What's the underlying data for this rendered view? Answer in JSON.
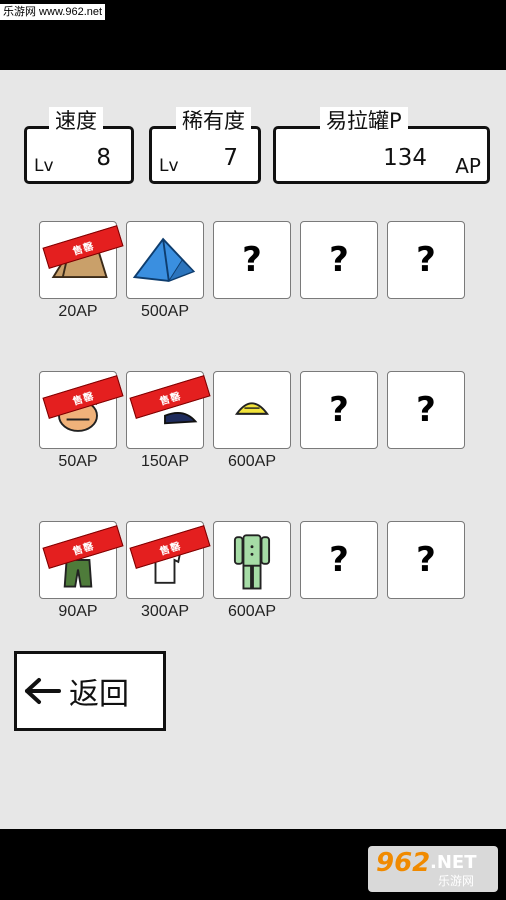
{
  "watermark_top": "乐游网 www.962.net",
  "stats": {
    "speed": {
      "title": "速度",
      "lv_label": "Lv",
      "value": "8"
    },
    "rarity": {
      "title": "稀有度",
      "lv_label": "Lv",
      "value": "7"
    },
    "cans": {
      "title": "易拉罐P",
      "value": "134",
      "unit": "AP"
    }
  },
  "sold_label": "售罄",
  "rows": [
    {
      "items": [
        {
          "kind": "mat-icon",
          "sold": true,
          "price": "20AP"
        },
        {
          "kind": "tent-icon",
          "sold": false,
          "price": "500AP"
        },
        {
          "kind": "question-icon",
          "sold": false,
          "price": "",
          "mark": "?"
        },
        {
          "kind": "question-icon",
          "sold": false,
          "price": "",
          "mark": "?"
        },
        {
          "kind": "question-icon",
          "sold": false,
          "price": "",
          "mark": "?"
        }
      ]
    },
    {
      "items": [
        {
          "kind": "face-icon",
          "sold": true,
          "price": "50AP"
        },
        {
          "kind": "cap-icon",
          "sold": true,
          "price": "150AP"
        },
        {
          "kind": "helmet-icon",
          "sold": false,
          "price": "600AP"
        },
        {
          "kind": "question-icon",
          "sold": false,
          "price": "",
          "mark": "?"
        },
        {
          "kind": "question-icon",
          "sold": false,
          "price": "",
          "mark": "?"
        }
      ]
    },
    {
      "items": [
        {
          "kind": "pants-icon",
          "sold": true,
          "price": "90AP"
        },
        {
          "kind": "shirt-icon",
          "sold": true,
          "price": "300AP"
        },
        {
          "kind": "overalls-icon",
          "sold": false,
          "price": "600AP"
        },
        {
          "kind": "question-icon",
          "sold": false,
          "price": "",
          "mark": "?"
        },
        {
          "kind": "question-icon",
          "sold": false,
          "price": "",
          "mark": "?"
        }
      ]
    }
  ],
  "back_button": {
    "arrow": "←",
    "label": "返回"
  },
  "watermark_bottom": {
    "num": "962",
    "net": ".NET",
    "cn": "乐游网"
  },
  "colors": {
    "sold_banner": "#e41f1f",
    "tent": "#3a8fe0",
    "helmet": "#f2e33a",
    "overalls": "#a6dca6"
  }
}
